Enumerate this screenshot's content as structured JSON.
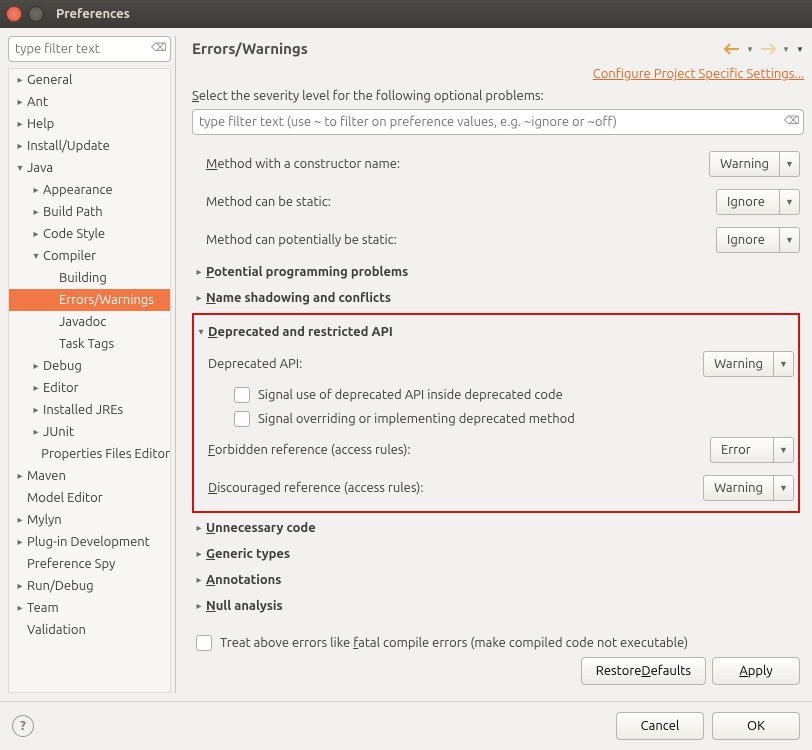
{
  "window": {
    "title": "Preferences"
  },
  "left": {
    "filter_placeholder": "type filter text",
    "tree": [
      {
        "label": "General",
        "depth": 1,
        "tw": "▸"
      },
      {
        "label": "Ant",
        "depth": 1,
        "tw": "▸"
      },
      {
        "label": "Help",
        "depth": 1,
        "tw": "▸"
      },
      {
        "label": "Install/Update",
        "depth": 1,
        "tw": "▸"
      },
      {
        "label": "Java",
        "depth": 1,
        "tw": "▾"
      },
      {
        "label": "Appearance",
        "depth": 2,
        "tw": "▸"
      },
      {
        "label": "Build Path",
        "depth": 2,
        "tw": "▸"
      },
      {
        "label": "Code Style",
        "depth": 2,
        "tw": "▸"
      },
      {
        "label": "Compiler",
        "depth": 2,
        "tw": "▾"
      },
      {
        "label": "Building",
        "depth": 3,
        "tw": ""
      },
      {
        "label": "Errors/Warnings",
        "depth": 3,
        "tw": "",
        "selected": true
      },
      {
        "label": "Javadoc",
        "depth": 3,
        "tw": ""
      },
      {
        "label": "Task Tags",
        "depth": 3,
        "tw": ""
      },
      {
        "label": "Debug",
        "depth": 2,
        "tw": "▸"
      },
      {
        "label": "Editor",
        "depth": 2,
        "tw": "▸"
      },
      {
        "label": "Installed JREs",
        "depth": 2,
        "tw": "▸"
      },
      {
        "label": "JUnit",
        "depth": 2,
        "tw": "▸"
      },
      {
        "label": "Properties Files Editor",
        "depth": 2,
        "tw": ""
      },
      {
        "label": "Maven",
        "depth": 1,
        "tw": "▸"
      },
      {
        "label": "Model Editor",
        "depth": 1,
        "tw": ""
      },
      {
        "label": "Mylyn",
        "depth": 1,
        "tw": "▸"
      },
      {
        "label": "Plug-in Development",
        "depth": 1,
        "tw": "▸"
      },
      {
        "label": "Preference Spy",
        "depth": 1,
        "tw": ""
      },
      {
        "label": "Run/Debug",
        "depth": 1,
        "tw": "▸"
      },
      {
        "label": "Team",
        "depth": 1,
        "tw": "▸"
      },
      {
        "label": "Validation",
        "depth": 1,
        "tw": ""
      }
    ]
  },
  "right": {
    "title": "Errors/Warnings",
    "project_link": "Configure Project Specific Settings...",
    "severity_label_pre": "S",
    "severity_label": "elect the severity level for the following optional problems:",
    "filter_placeholder": "type filter text (use ~ to filter on preference values, e.g. ~ignore or ~off)",
    "rows_top": [
      {
        "label_pre": "M",
        "label": "ethod with a constructor name:",
        "value": "Warning"
      },
      {
        "label": "Method can be static:",
        "value": "Ignore"
      },
      {
        "label": "Method can potentially be static:",
        "value": "Ignore"
      }
    ],
    "sections_before": [
      {
        "label_pre": "P",
        "label": "otential programming problems"
      },
      {
        "label_pre": "N",
        "label": "ame shadowing and conflicts"
      }
    ],
    "boxed": {
      "header_pre": "D",
      "header": "eprecated and restricted API",
      "row1": {
        "label": "Deprecated API:",
        "value": "Warning"
      },
      "chk1": "Signal use of deprecated API inside deprecated code",
      "chk2": "Signal overriding or implementing deprecated method",
      "row2": {
        "label_pre": "F",
        "label": "orbidden reference (access rules):",
        "value": "Error"
      },
      "row3": {
        "label_pre": "D",
        "label": "iscouraged reference (access rules):",
        "value": "Warning"
      }
    },
    "sections_after": [
      {
        "label_pre": "U",
        "label": "nnecessary code"
      },
      {
        "label_pre": "G",
        "label": "eneric types"
      },
      {
        "label_pre": "A",
        "label": "nnotations"
      },
      {
        "label_pre": "N",
        "label": "ull analysis"
      }
    ],
    "treat_pre": "Treat above errors like ",
    "treat_u": "f",
    "treat_post": "atal compile errors (make compiled code not executable)",
    "btn_restore_pre": "Restore ",
    "btn_restore_u": "D",
    "btn_restore_post": "efaults",
    "btn_apply_pre": "",
    "btn_apply_u": "A",
    "btn_apply_post": "pply"
  },
  "footer": {
    "cancel": "Cancel",
    "ok": "OK"
  }
}
